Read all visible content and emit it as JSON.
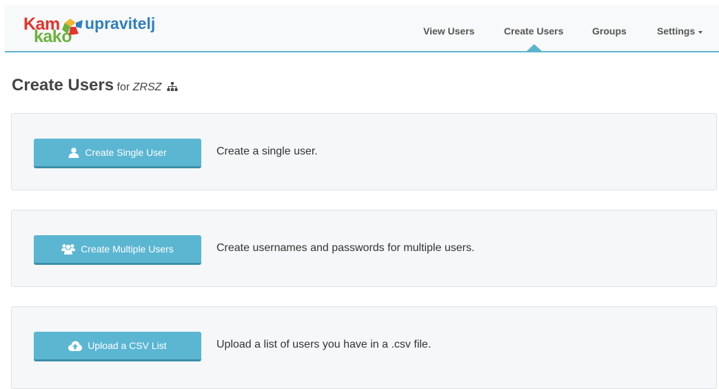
{
  "brand": {
    "kam": "Kam",
    "kako": "kako",
    "name": "upravitelj"
  },
  "nav": {
    "items": [
      {
        "label": "View Users"
      },
      {
        "label": "Create Users",
        "active": true
      },
      {
        "label": "Groups"
      },
      {
        "label": "Settings",
        "dropdown": true
      }
    ]
  },
  "page": {
    "title": "Create Users",
    "for_label": "for",
    "organization": "ZRSZ",
    "organization_icon": "sitemap-icon"
  },
  "actions": [
    {
      "button_label": "Create Single User",
      "icon": "user-icon",
      "description": "Create a single user."
    },
    {
      "button_label": "Create Multiple Users",
      "icon": "users-icon",
      "description": "Create usernames and passwords for multiple users."
    },
    {
      "button_label": "Upload a CSV List",
      "icon": "cloud-upload-icon",
      "description": "Upload a list of users you have in a .csv file."
    }
  ],
  "colors": {
    "accent": "#5bb6d2",
    "brand_red": "#e2342b",
    "brand_green": "#6ab23d",
    "brand_blue": "#2f7fbf"
  }
}
